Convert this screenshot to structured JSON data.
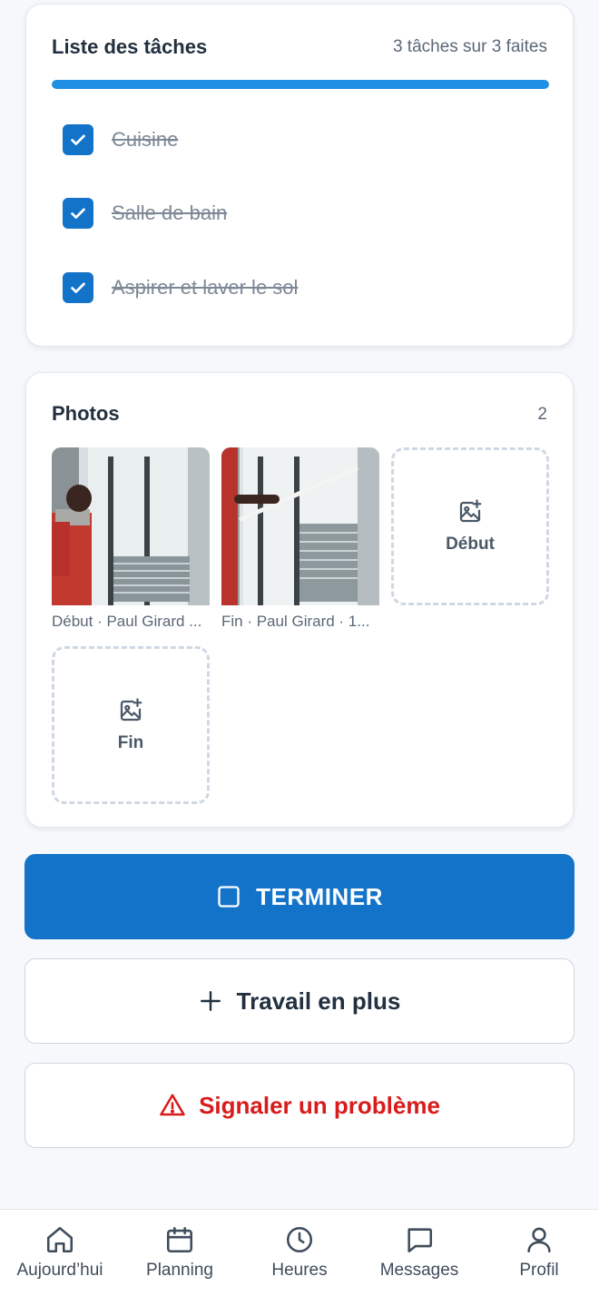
{
  "tasks": {
    "title": "Liste des tâches",
    "progress_text": "3 tâches sur 3 faites",
    "progress": 1.0,
    "items": [
      {
        "label": "Cuisine",
        "done": true
      },
      {
        "label": "Salle de bain",
        "done": true
      },
      {
        "label": "Aspirer et laver le sol",
        "done": true
      }
    ]
  },
  "photos": {
    "title": "Photos",
    "count": "2",
    "items": [
      {
        "caption": "Début · Paul Girard ..."
      },
      {
        "caption": "Fin · Paul Girard · 1..."
      }
    ],
    "slots": [
      {
        "label": "Début"
      },
      {
        "label": "Fin"
      }
    ]
  },
  "actions": {
    "finish_label": "TERMINER",
    "extra_work_label": "Travail en plus",
    "report_problem_label": "Signaler un problème"
  },
  "nav": {
    "items": [
      {
        "label": "Aujourd’hui",
        "icon": "home-icon"
      },
      {
        "label": "Planning",
        "icon": "calendar-icon"
      },
      {
        "label": "Heures",
        "icon": "clock-icon"
      },
      {
        "label": "Messages",
        "icon": "chat-icon"
      },
      {
        "label": "Profil",
        "icon": "user-icon"
      }
    ]
  },
  "colors": {
    "primary": "#1273c9",
    "progress": "#1f8fe5",
    "danger": "#d81b1b"
  }
}
